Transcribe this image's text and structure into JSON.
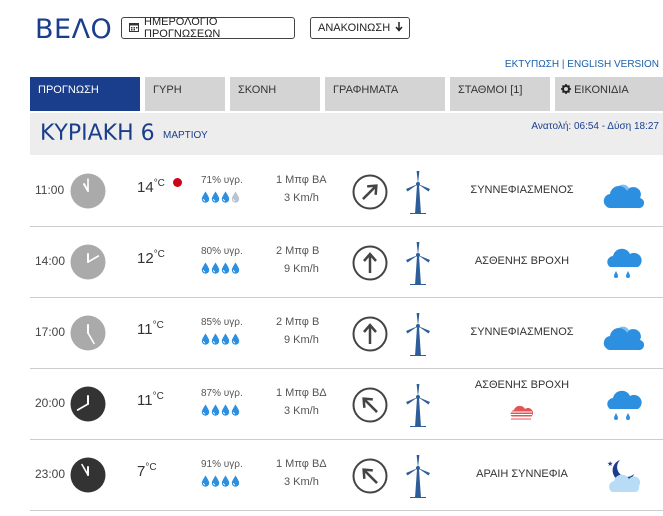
{
  "header": {
    "title": "ΒΕΛΟ",
    "calendar_button": "ΗΜΕΡΟΛΟΓΙΟ ΠΡΟΓΝΩΣΕΩΝ",
    "announce_button": "ΑΝΑΚΟΙΝΩΣΗ",
    "print_link": "ΕΚΤΥΠΩΣΗ",
    "separator": "|",
    "english_link": "ENGLISH VERSION"
  },
  "tabs": [
    {
      "label": "ΠΡΟΓΝΩΣΗ",
      "active": true
    },
    {
      "label": "ΓΥΡΗ",
      "active": false
    },
    {
      "label": "ΣΚΟΝΗ",
      "active": false
    },
    {
      "label": "ΓΡΑΦΗΜΑΤΑ",
      "active": false
    },
    {
      "label": "ΣΤΑΘΜΟΙ [1]",
      "active": false
    },
    {
      "label": "ΕΙΚΟΝΙΔΙΑ",
      "active": false
    }
  ],
  "day": {
    "name": "ΚΥΡΙΑΚΗ 6",
    "month": "ΜΑΡΤΙΟΥ",
    "sun": "Ανατολή: 06:54 - Δύση 18:27"
  },
  "rows": [
    {
      "time": "11:00",
      "temp": "14",
      "unit": "°C",
      "humidity": "71% υγρ.",
      "wind_bf": "1 Μπφ ΒΑ",
      "wind_kmh": "3 Km/h",
      "desc": "ΣΥΝΝΕΦΙΑΣΜΕΝΟΣ",
      "alert": true,
      "drops_full": 3
    },
    {
      "time": "14:00",
      "temp": "12",
      "unit": "°C",
      "humidity": "80% υγρ.",
      "wind_bf": "2 Μπφ Β",
      "wind_kmh": "9 Km/h",
      "desc": "ΑΣΘΕΝΗΣ ΒΡΟΧΗ",
      "alert": false,
      "drops_full": 4
    },
    {
      "time": "17:00",
      "temp": "11",
      "unit": "°C",
      "humidity": "85% υγρ.",
      "wind_bf": "2 Μπφ Β",
      "wind_kmh": "9 Km/h",
      "desc": "ΣΥΝΝΕΦΙΑΣΜΕΝΟΣ",
      "alert": false,
      "drops_full": 4
    },
    {
      "time": "20:00",
      "temp": "11",
      "unit": "°C",
      "humidity": "87% υγρ.",
      "wind_bf": "1 Μπφ ΒΔ",
      "wind_kmh": "3 Km/h",
      "desc": "ΑΣΘΕΝΗΣ ΒΡΟΧΗ",
      "alert": false,
      "drops_full": 4
    },
    {
      "time": "23:00",
      "temp": "7",
      "unit": "°C",
      "humidity": "91% υγρ.",
      "wind_bf": "1 Μπφ ΒΔ",
      "wind_kmh": "3 Km/h",
      "desc": "ΑΡΑΙΗ ΣΥΝΝΕΦΙΑ",
      "alert": false,
      "drops_full": 4
    }
  ],
  "colors": {
    "brand": "#1a3e8c",
    "tab_bg": "#d4d4d4",
    "alert": "#d0021b",
    "drop": "#2d8fe0",
    "icon_blue": "#2d8fe0"
  }
}
